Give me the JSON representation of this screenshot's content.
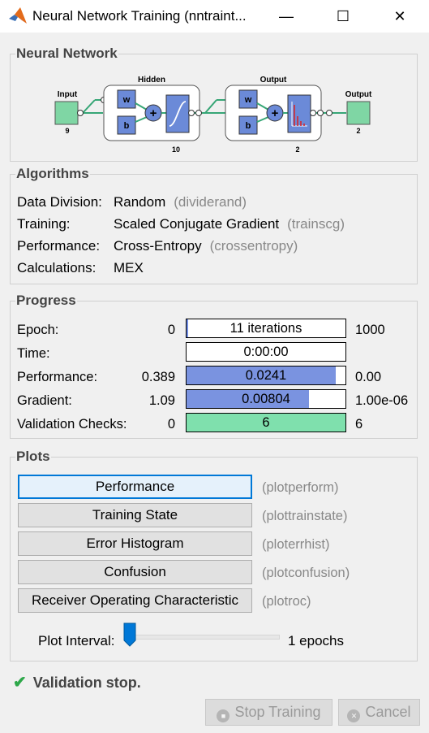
{
  "window": {
    "title": "Neural Network Training (nntraint...",
    "min_glyph": "—",
    "max_glyph": "☐",
    "close_glyph": "✕"
  },
  "network": {
    "section_title": "Neural Network",
    "input_label": "Input",
    "input_size": "9",
    "hidden_label": "Hidden",
    "hidden_size": "10",
    "output_layer_label": "Output",
    "output_layer_size": "2",
    "output_label": "Output",
    "output_size": "2",
    "weight_label": "w",
    "bias_label": "b"
  },
  "algorithms": {
    "section_title": "Algorithms",
    "rows": [
      {
        "label": "Data Division:",
        "value": "Random",
        "fn": "(dividerand)"
      },
      {
        "label": "Training:",
        "value": "Scaled Conjugate Gradient",
        "fn": "(trainscg)"
      },
      {
        "label": "Performance:",
        "value": "Cross-Entropy",
        "fn": "(crossentropy)"
      },
      {
        "label": "Calculations:",
        "value": "MEX",
        "fn": ""
      }
    ]
  },
  "progress": {
    "section_title": "Progress",
    "rows": [
      {
        "label": "Epoch:",
        "min": "0",
        "value": "11 iterations",
        "max": "1000",
        "fill": 0.011,
        "color": "#6e89e0"
      },
      {
        "label": "Time:",
        "min": "",
        "value": "0:00:00",
        "max": "",
        "fill": 0,
        "color": "#6e89e0"
      },
      {
        "label": "Performance:",
        "min": "0.389",
        "value": "0.0241",
        "max": "0.00",
        "fill": 0.94,
        "color": "#7a93e0"
      },
      {
        "label": "Gradient:",
        "min": "1.09",
        "value": "0.00804",
        "max": "1.00e-06",
        "fill": 0.77,
        "color": "#7a93e0"
      },
      {
        "label": "Validation Checks:",
        "min": "0",
        "value": "6",
        "max": "6",
        "fill": 1.0,
        "color": "#7fe0ad"
      }
    ]
  },
  "plots": {
    "section_title": "Plots",
    "buttons": [
      {
        "label": "Performance",
        "fn": "(plotperform)"
      },
      {
        "label": "Training State",
        "fn": "(plottrainstate)"
      },
      {
        "label": "Error Histogram",
        "fn": "(ploterrhist)"
      },
      {
        "label": "Confusion",
        "fn": "(plotconfusion)"
      },
      {
        "label": "Receiver Operating Characteristic",
        "fn": "(plotroc)"
      }
    ],
    "interval_label": "Plot Interval:",
    "interval_value": "1 epochs",
    "interval_slider_value": 1
  },
  "status": {
    "check_glyph": "✔",
    "text": "Validation stop."
  },
  "actions": {
    "stop_label": "Stop Training",
    "stop_glyph": "■",
    "cancel_label": "Cancel",
    "cancel_glyph": "✕"
  }
}
